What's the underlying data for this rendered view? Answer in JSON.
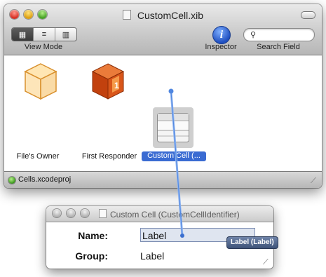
{
  "main_window": {
    "title": "CustomCell.xib",
    "toolbar": {
      "view_mode_label": "View Mode",
      "inspector_label": "Inspector",
      "search_label": "Search Field",
      "inspector_glyph": "i",
      "view_mode_segments": [
        {
          "icon": "icon-view-icon",
          "glyph": "▦",
          "selected": true
        },
        {
          "icon": "list-view-icon",
          "glyph": "≡",
          "selected": false
        },
        {
          "icon": "column-view-icon",
          "glyph": "▥",
          "selected": false
        }
      ]
    },
    "items": {
      "files_owner": "File's Owner",
      "first_responder": "First Responder",
      "custom_cell": "Custom Cell (..."
    },
    "status_bar": {
      "project": "Cells.xcodeproj"
    }
  },
  "panel": {
    "title": "Custom Cell (CustomCellIdentifier)",
    "name_label": "Name:",
    "name_value": "Label",
    "group_label": "Group:",
    "group_value": "Label"
  },
  "tooltip": {
    "text": "Label (Label)"
  },
  "colors": {
    "selection_blue": "#3a6bd2",
    "connection_line": "#6e9be6",
    "status_green": "#2f8f12"
  }
}
